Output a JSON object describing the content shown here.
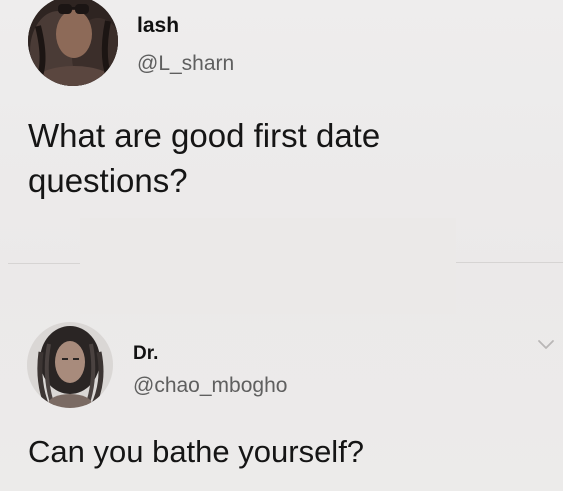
{
  "tweet": {
    "name": "lash",
    "handle": "@L_sharn",
    "text": "What are good first date questions?"
  },
  "reply": {
    "name": "Dr.",
    "handle": "@chao_mbogho",
    "text": "Can you bathe yourself?"
  },
  "icons": {
    "more": "chevron-down-icon"
  },
  "colors": {
    "background": "#eceaea",
    "text": "#151515",
    "handle": "#5f5f5f",
    "chevron": "#b9b7b6"
  }
}
